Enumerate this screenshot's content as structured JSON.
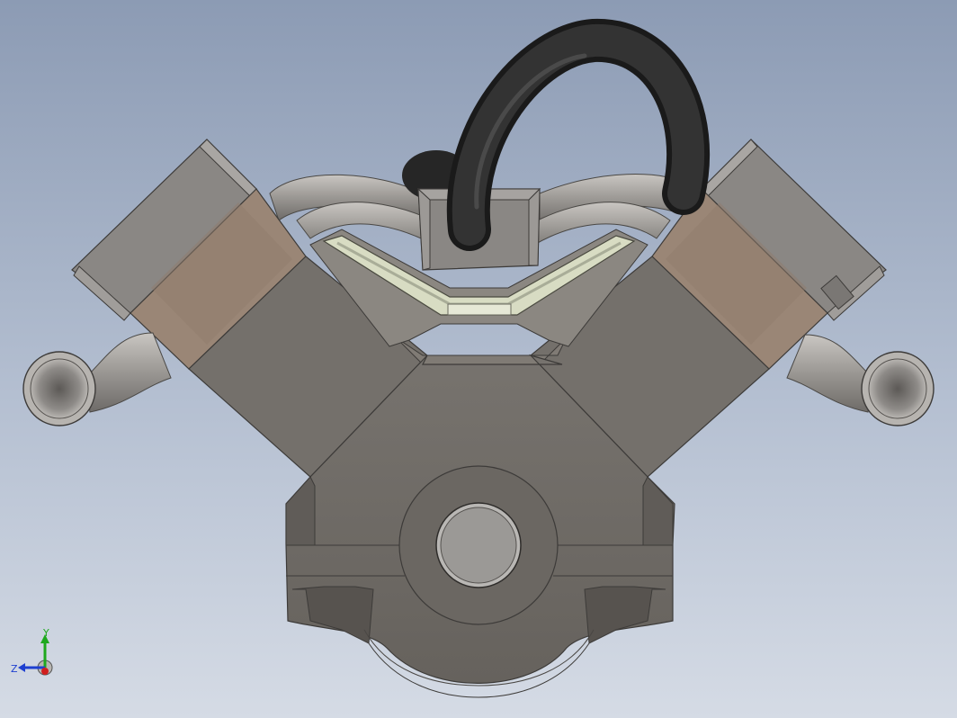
{
  "viewport": {
    "background_top": "#8c9bb4",
    "background_bottom": "#d5dbe5"
  },
  "model": {
    "body_color": "#6f6b66",
    "body_dark": "#5c5853",
    "body_light": "#807b75",
    "band_color": "#9a8676",
    "cap_color": "#8a8784",
    "pipe_color": "#9b9894",
    "hose_color": "#2e2e2e",
    "gasket_color": "#d8dcc3"
  },
  "triad": {
    "y_label": "Y",
    "z_label": "Z",
    "y_color": "#1ea81e",
    "z_color": "#1e3fd0",
    "x_color": "#d01e1e"
  }
}
